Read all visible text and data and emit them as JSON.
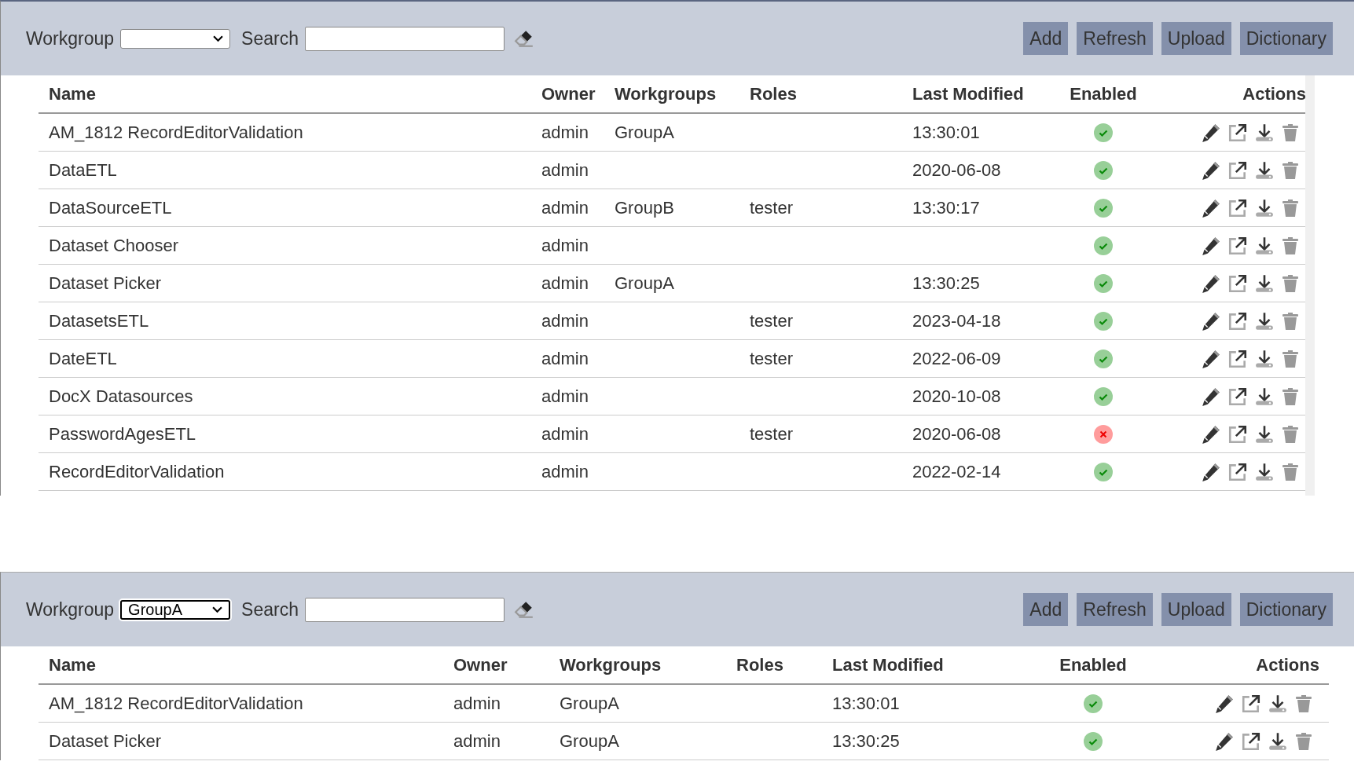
{
  "panels": [
    {
      "toolbar": {
        "workgroup_label": "Workgroup",
        "search_label": "Search",
        "buttons": [
          "Add",
          "Refresh",
          "Upload",
          "Dictionary"
        ]
      },
      "table": {
        "columns": [
          "Name",
          "Owner",
          "Workgroups",
          "Roles",
          "Last Modified",
          "Enabled",
          "Actions"
        ],
        "rows": [
          {
            "name": "AM_1812 RecordEditorValidation",
            "owner": "admin",
            "workgroups": "GroupA",
            "last_modified": "13:30:01",
            "enabled": true
          },
          {
            "name": "DataETL",
            "owner": "admin",
            "last_modified": "2020-06-08",
            "enabled": true
          },
          {
            "name": "DataSourceETL",
            "owner": "admin",
            "workgroups": "GroupB",
            "roles": "tester",
            "last_modified": "13:30:17",
            "enabled": true
          },
          {
            "name": "Dataset Chooser",
            "owner": "admin",
            "enabled": true
          },
          {
            "name": "Dataset Picker",
            "owner": "admin",
            "workgroups": "GroupA",
            "last_modified": "13:30:25",
            "enabled": true
          },
          {
            "name": "DatasetsETL",
            "owner": "admin",
            "roles": "tester",
            "last_modified": "2023-04-18",
            "enabled": true
          },
          {
            "name": "DateETL",
            "owner": "admin",
            "roles": "tester",
            "last_modified": "2022-06-09",
            "enabled": true
          },
          {
            "name": "DocX Datasources",
            "owner": "admin",
            "last_modified": "2020-10-08",
            "enabled": true
          },
          {
            "name": "PasswordAgesETL",
            "owner": "admin",
            "roles": "tester",
            "last_modified": "2020-06-08",
            "enabled": false
          },
          {
            "name": "RecordEditorValidation",
            "owner": "admin",
            "last_modified": "2022-02-14",
            "enabled": true
          }
        ]
      }
    },
    {
      "toolbar": {
        "workgroup_label": "Workgroup",
        "workgroup_value": "GroupA",
        "search_label": "Search",
        "buttons": [
          "Add",
          "Refresh",
          "Upload",
          "Dictionary"
        ]
      },
      "table": {
        "columns": [
          "Name",
          "Owner",
          "Workgroups",
          "Roles",
          "Last Modified",
          "Enabled",
          "Actions"
        ],
        "rows": [
          {
            "name": "AM_1812 RecordEditorValidation",
            "owner": "admin",
            "workgroups": "GroupA",
            "last_modified": "13:30:01",
            "enabled": true
          },
          {
            "name": "Dataset Picker",
            "owner": "admin",
            "workgroups": "GroupA",
            "last_modified": "13:30:25",
            "enabled": true
          }
        ]
      }
    }
  ]
}
